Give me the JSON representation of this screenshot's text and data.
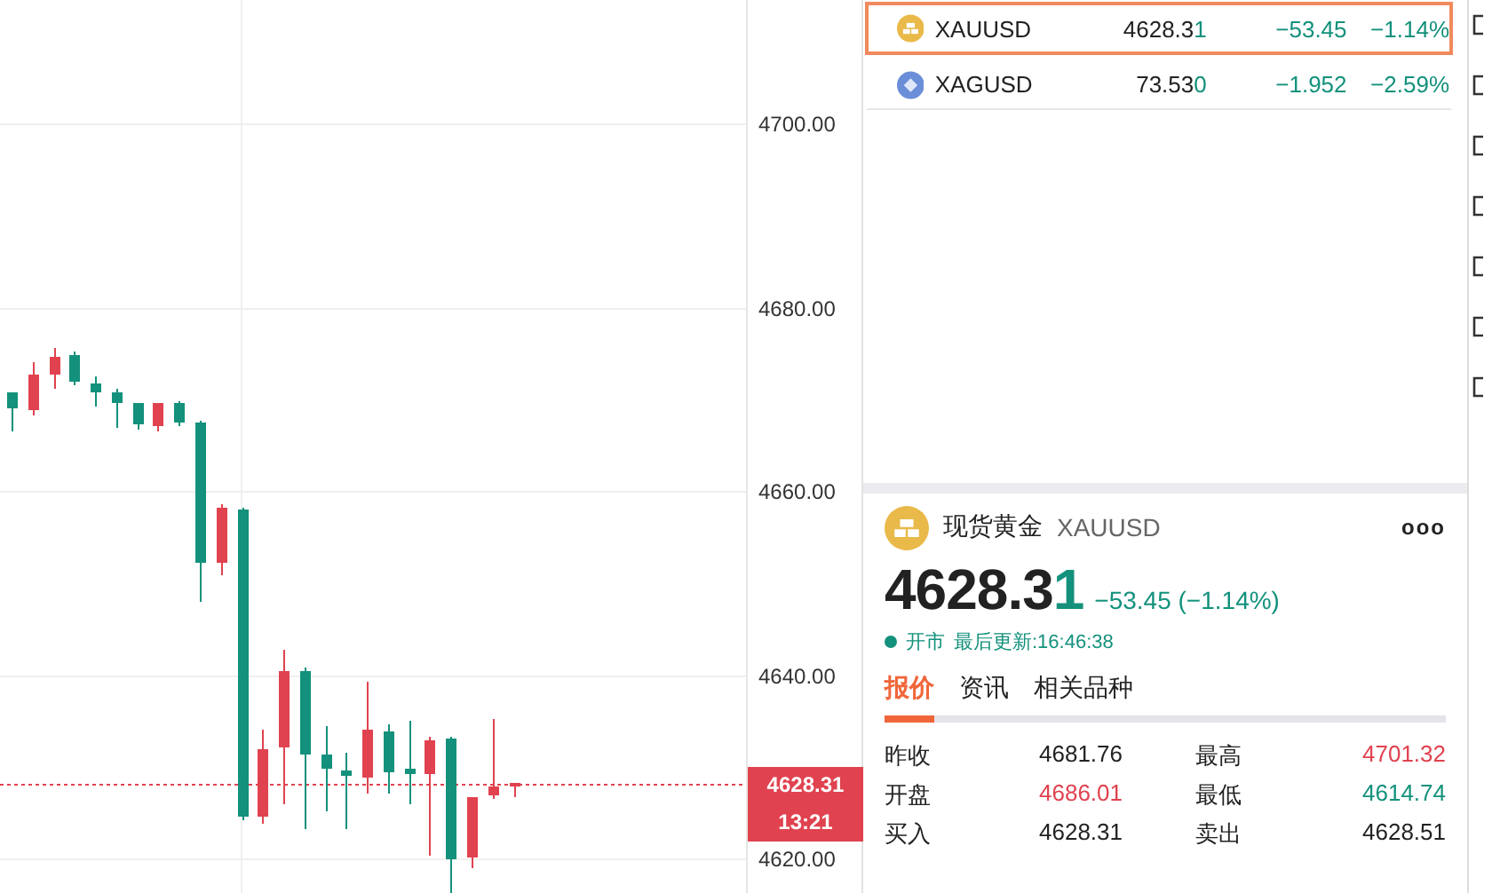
{
  "chart": {
    "axis_ticks": [
      "4700.00",
      "4680.00",
      "4660.00",
      "4640.00",
      "4620.00"
    ],
    "current_price": "4628.31",
    "countdown": "13:21"
  },
  "watchlist": [
    {
      "symbol": "XAUUSD",
      "kind": "gold",
      "price_main": "4628.3",
      "price_last": "1",
      "change": "−53.45",
      "percent": "−1.14%",
      "selected": true
    },
    {
      "symbol": "XAGUSD",
      "kind": "silver",
      "price_main": "73.53",
      "price_last": "0",
      "change": "−1.952",
      "percent": "−2.59%",
      "selected": false
    }
  ],
  "detail": {
    "name": "现货黄金",
    "symbol": "XAUUSD",
    "more": "ooo",
    "price_main": "4628.3",
    "price_last": "1",
    "change": "−53.45 (−1.14%)",
    "market_status": "开市",
    "updated": "最后更新:16:46:38",
    "tabs": [
      {
        "label": "报价",
        "selected": true
      },
      {
        "label": "资讯",
        "selected": false
      },
      {
        "label": "相关品种",
        "selected": false
      }
    ],
    "stats": [
      {
        "label": "昨收",
        "value": "4681.76",
        "color": "#222222"
      },
      {
        "label": "最高",
        "value": "4701.32",
        "color": "#e0424f"
      },
      {
        "label": "开盘",
        "value": "4686.01",
        "color": "#e0424f"
      },
      {
        "label": "最低",
        "value": "4614.74",
        "color": "#13917c"
      },
      {
        "label": "买入",
        "value": "4628.31",
        "color": "#222222"
      },
      {
        "label": "卖出",
        "value": "4628.51",
        "color": "#222222"
      }
    ]
  }
}
